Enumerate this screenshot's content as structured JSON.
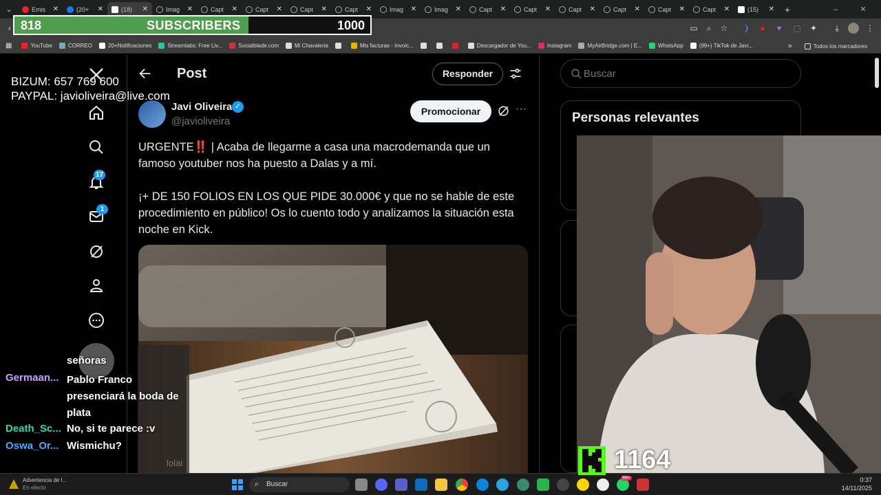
{
  "browser": {
    "tabs": [
      {
        "title": "Emis",
        "icon": "youtube-icon"
      },
      {
        "title": "(20+",
        "icon": "facebook-icon"
      },
      {
        "title": "(18)",
        "icon": "x-icon",
        "active": true
      },
      {
        "title": "Imag",
        "icon": "globe-icon"
      },
      {
        "title": "Capt",
        "icon": "globe-icon"
      },
      {
        "title": "Capt",
        "icon": "globe-icon"
      },
      {
        "title": "Capt",
        "icon": "globe-icon"
      },
      {
        "title": "Capt",
        "icon": "globe-icon"
      },
      {
        "title": "Imag",
        "icon": "globe-icon"
      },
      {
        "title": "Imag",
        "icon": "globe-icon"
      },
      {
        "title": "Capt",
        "icon": "globe-icon"
      },
      {
        "title": "Capt",
        "icon": "globe-icon"
      },
      {
        "title": "Capt",
        "icon": "globe-icon"
      },
      {
        "title": "Capt",
        "icon": "globe-icon"
      },
      {
        "title": "Capt",
        "icon": "globe-icon"
      },
      {
        "title": "Capt",
        "icon": "globe-icon"
      },
      {
        "title": "(15)",
        "icon": "x-icon"
      }
    ],
    "new_tab": "+",
    "bookmarks": [
      {
        "label": "YouTube",
        "color": "#e22"
      },
      {
        "label": "CORREO",
        "color": "#7ab"
      },
      {
        "label": "20+Notificaciones",
        "color": "#fff"
      },
      {
        "label": "Streamlabs: Free Liv...",
        "color": "#31c3a2"
      },
      {
        "label": "Socialblade.com",
        "color": "#c33"
      },
      {
        "label": "Mi Chavaleria",
        "color": "#ddd"
      },
      {
        "label": "",
        "color": "#ddd"
      },
      {
        "label": "Mis facturas - Invoic...",
        "color": "#e8b400"
      },
      {
        "label": "",
        "color": "#ddd"
      },
      {
        "label": "",
        "color": "#ddd"
      },
      {
        "label": "",
        "color": "#d22"
      },
      {
        "label": "Descargador de You...",
        "color": "#ddd"
      },
      {
        "label": "Instagram",
        "color": "#d62976"
      },
      {
        "label": "MyAirBridge.com | E...",
        "color": "#aaa"
      },
      {
        "label": "WhatsApp",
        "color": "#25d366"
      },
      {
        "label": "(99+) TikTok de Javi...",
        "color": "#fff"
      }
    ],
    "bookmarks_more": "»",
    "all_bookmarks": "Todos los marcadores"
  },
  "overlay": {
    "subscribers": {
      "count": "818",
      "label": "SUBSCRIBERS",
      "goal": "1000",
      "progress": 0.818
    },
    "donation": {
      "bizum": "BIZUM: 657 769 600",
      "paypal": "PAYPAL: javioliveira@live.com"
    },
    "kick_viewers": "1164",
    "chat": [
      {
        "user": "",
        "message": "señoras",
        "color": "#fff"
      },
      {
        "user": "Germaan...",
        "message": "Pablo Franco presenciará la boda de plata",
        "color": "#c9a0ff"
      },
      {
        "user": "Death_Sc...",
        "message": "No, si te parece :v",
        "color": "#30d9b0"
      },
      {
        "user": "Oswa_Or...",
        "message": "Wismichu?",
        "color": "#4aa8ff"
      }
    ],
    "chat_bg_text": "lolai"
  },
  "sidebar": {
    "notifications_count": "17",
    "messages_count": "1"
  },
  "post": {
    "header": "Post",
    "reply_button": "Responder",
    "promote_button": "Promocionar",
    "author_name": "Javi Oliveira",
    "author_handle": "@javioliveira",
    "text_line1": "URGENTE‼️ | Acaba de llegarme a casa una macrodemanda que un",
    "text_line2": "famoso youtuber nos ha puesto a Dalas y a mí.",
    "text_line3": "¡+ DE 150 FOLIOS EN LOS QUE PIDE 30.000€ y que no se hable de este",
    "text_line4": "procedimiento en público! Os lo cuento todo y analizamos la situación esta",
    "text_line5": "noche en Kick."
  },
  "right": {
    "search_placeholder": "Buscar",
    "relevant_title": "Personas relevantes"
  },
  "taskbar": {
    "warning_title": "Advertencia de l...",
    "warning_sub": "En efecto",
    "search_placeholder": "Buscar",
    "time": "0:37",
    "date": "14/11/2025",
    "whatsapp_badge": "99+"
  }
}
